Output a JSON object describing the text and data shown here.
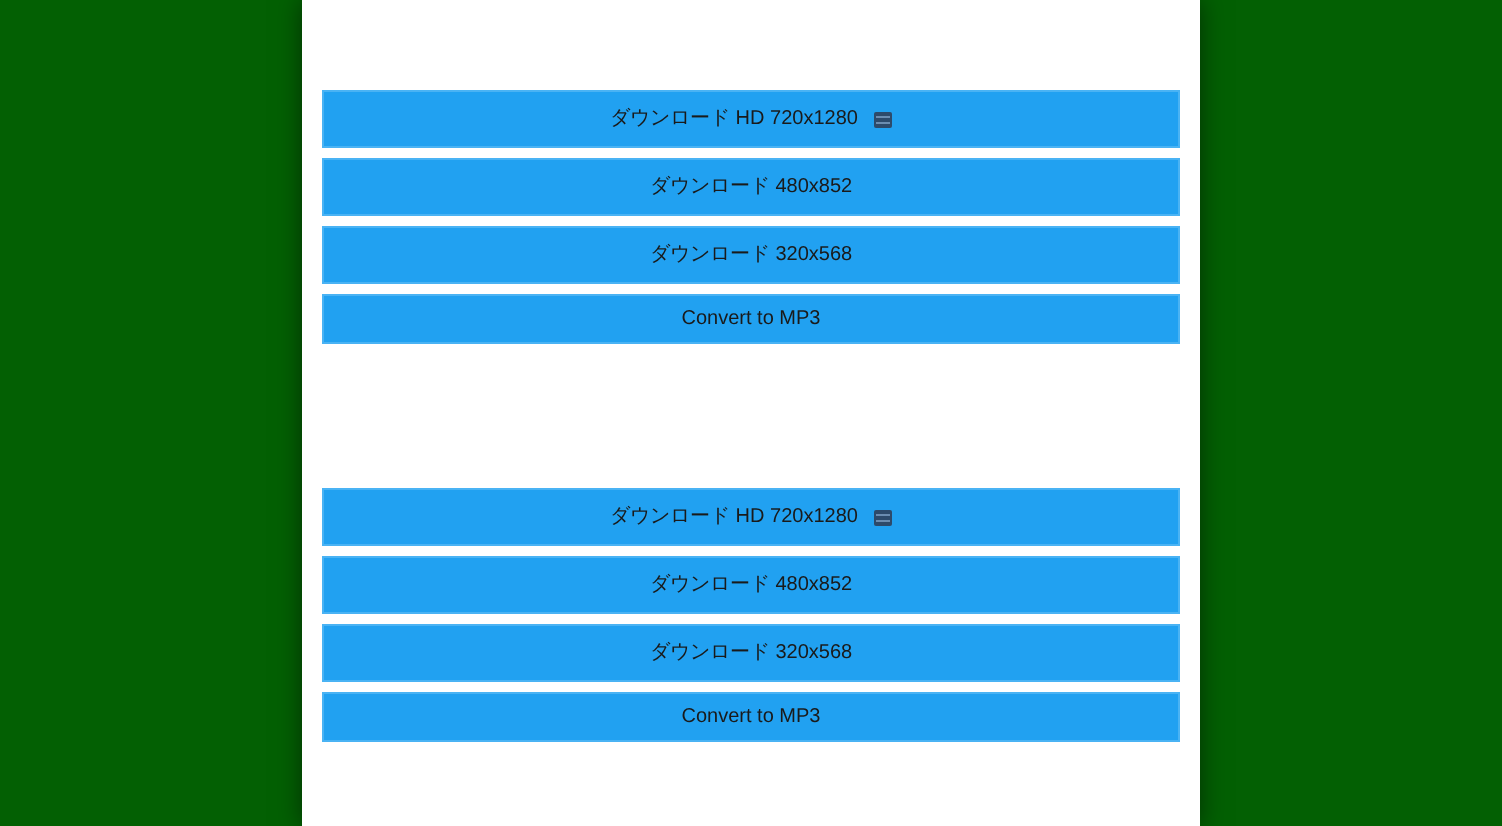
{
  "groups": [
    {
      "buttons": [
        {
          "kind": "hd",
          "label": "ダウンロード HD 720x1280"
        },
        {
          "kind": "download",
          "label": "ダウンロード 480x852"
        },
        {
          "kind": "download",
          "label": "ダウンロード 320x568"
        },
        {
          "kind": "convert",
          "label": "Convert to MP3"
        }
      ]
    },
    {
      "buttons": [
        {
          "kind": "hd",
          "label": "ダウンロード HD 720x1280"
        },
        {
          "kind": "download",
          "label": "ダウンロード 480x852"
        },
        {
          "kind": "download",
          "label": "ダウンロード 320x568"
        },
        {
          "kind": "convert",
          "label": "Convert to MP3"
        }
      ]
    }
  ]
}
